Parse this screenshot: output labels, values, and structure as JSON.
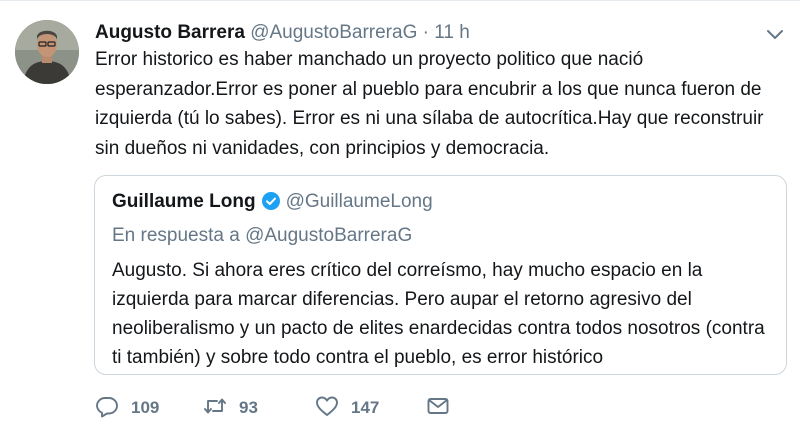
{
  "tweet": {
    "author_name": "Augusto Barrera",
    "author_handle": "@AugustoBarreraG",
    "separator": "·",
    "time": "11 h",
    "text": "Error historico es haber manchado un proyecto politico que nació esperanzador.Error es poner al pueblo para encubrir a los que nunca fueron de izquierda (tú lo sabes). Error es ni una sílaba de autocrítica.Hay que reconstruir sin dueños ni vanidades, con principios y democracia."
  },
  "quoted_tweet": {
    "author_name": "Guillaume Long",
    "author_handle": "@GuillaumeLong",
    "reply_to": "En respuesta a @AugustoBarreraG",
    "text": "Augusto. Si ahora eres crítico del correísmo, hay mucho espacio en la izquierda para marcar diferencias. Pero aupar el retorno agresivo del neoliberalismo y un pacto de elites enardecidas contra todos nosotros (contra ti también) y sobre todo contra el pueblo, es error histórico"
  },
  "actions": {
    "reply_count": "109",
    "retweet_count": "93",
    "like_count": "147"
  },
  "icons": {
    "reply": "reply-icon",
    "retweet": "retweet-icon",
    "like": "heart-icon",
    "dm": "envelope-icon",
    "menu": "chevron-down-icon",
    "verified": "verified-badge-icon"
  },
  "colors": {
    "text": "#14171a",
    "secondary": "#657786",
    "border": "#ccd6dd",
    "verified": "#1da1f2"
  }
}
